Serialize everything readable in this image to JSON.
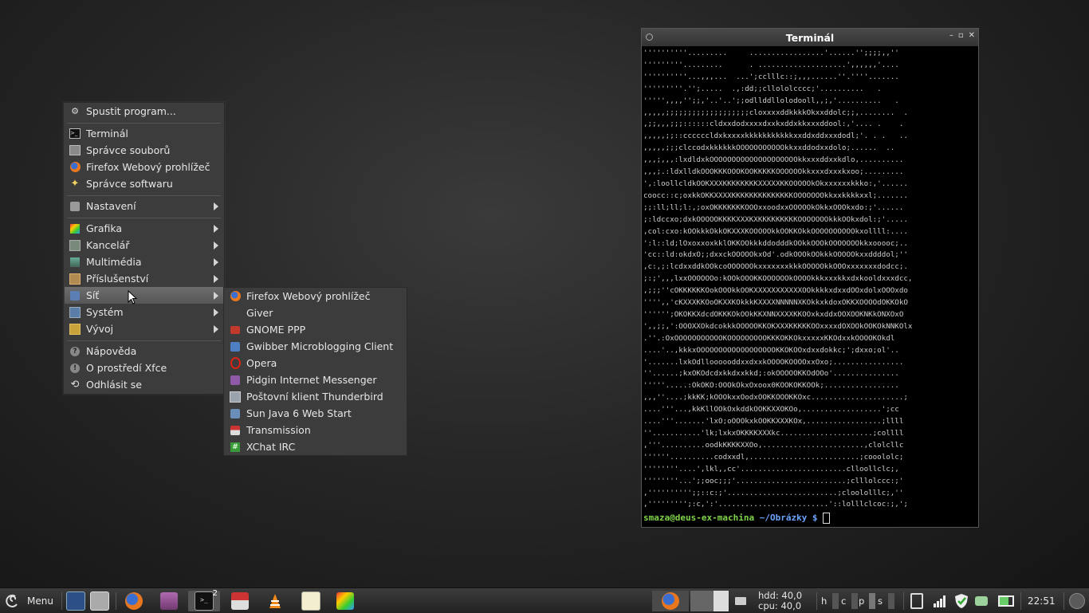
{
  "menu": {
    "items": [
      {
        "label": "Spustit program...",
        "icon": "gear-icon"
      },
      {
        "label": "Terminál",
        "icon": "terminal-icon"
      },
      {
        "label": "Správce souborů",
        "icon": "file-manager-icon"
      },
      {
        "label": "Firefox Webový prohlížeč",
        "icon": "firefox-icon"
      },
      {
        "label": "Správce softwaru",
        "icon": "software-star-icon"
      },
      {
        "label": "Nastavení",
        "icon": "settings-icon"
      },
      {
        "label": "Grafika",
        "icon": "graphics-icon"
      },
      {
        "label": "Kancelář",
        "icon": "office-icon"
      },
      {
        "label": "Multimédia",
        "icon": "multimedia-icon"
      },
      {
        "label": "Příslušenství",
        "icon": "accessories-icon"
      },
      {
        "label": "Síť",
        "icon": "network-icon"
      },
      {
        "label": "Systém",
        "icon": "system-icon"
      },
      {
        "label": "Vývoj",
        "icon": "development-icon"
      },
      {
        "label": "Nápověda",
        "icon": "help-icon"
      },
      {
        "label": "O prostředí Xfce",
        "icon": "info-icon"
      },
      {
        "label": "Odhlásit se",
        "icon": "logout-icon"
      }
    ]
  },
  "submenu": {
    "items": [
      {
        "label": "Firefox Webový prohlížeč",
        "icon": "firefox-icon"
      },
      {
        "label": "Giver",
        "icon": "giver-icon"
      },
      {
        "label": "GNOME PPP",
        "icon": "modem-icon"
      },
      {
        "label": "Gwibber Microblogging Client",
        "icon": "gwibber-icon"
      },
      {
        "label": "Opera",
        "icon": "opera-icon"
      },
      {
        "label": "Pidgin Internet Messenger",
        "icon": "pidgin-icon"
      },
      {
        "label": "Poštovní klient Thunderbird",
        "icon": "mail-icon"
      },
      {
        "label": "Sun Java 6 Web Start",
        "icon": "java-icon"
      },
      {
        "label": "Transmission",
        "icon": "transmission-icon"
      },
      {
        "label": "XChat IRC",
        "icon": "xchat-icon"
      }
    ]
  },
  "terminal": {
    "title": "Terminál",
    "ascii_art": "''''''''''.........     .................'......'';;;;,,''\n'''''''''.........      . ....................',,,,,,'....\n''''''''''...,,,...  ...';cclllc::;,,,......''.''''.......\n'''''''''.'';.....  .,:dd;;cllololcccc;'..........   .\n''''',,,,'';;,'..'..';;odllddllolodooll,,;,'..........   .\n,,,,,;;;;;;;;;;;;;;;;;;;cloxxxxddkkkkOkxxddolc;;,........  .\n,;;,,,;;;::::::cldxxdodxxxxdxxkxddxkkxxxddool:,'.... .    .\n,,,,,;;::ccccccldxkxxxxkkkkkkkkkkkxxddxddxxxdodl;'. . .   ..\n,,,,,;;;clccodxkkkkkkOOOOOOOOOOOkkxxddodxxdolo;......  ..\n,,,;,,,:lxdldxkOOOOOOOOOOOOOOOOOOOOkkxxxddxxkdlo,..........\n,,,;.:ldxlldkOOOKKKOOOKOOKKKKKOOOOOOkkxxxdxxxkxoo;.........\n',:loollcldkOOKXXXKKKKKKKKXXXXXKKOOOOOkOkxxxxxxkkko:,'......\ncoocc::c;oxkkOKKXXXXKKKKKKKKKKKKKKOOOOOOOkkxxkkkkxxl;.......\n;;:ll;ll;l:,;oxOKKKKKKKOOOxxoodxxOOOOOkOkkxOOOkxdo:;'......\n;:ldccxo;dxkOOOOOKKKKXXXKXKKKKKKKKKOOOOOOOkkkOOkxdol:;'.....\n,col:cxo:kOOkkkOkkOKXXXKOOOOOkkOOKKOkkOOOOOOOOOOkxollll:....\n':l::ld;lOxoxxoxkklOKKOOkkkddodddkOOkkOOOkOOOOOOOkkxooooc;..\n'cc::ld:okdxO;;dxxckOOOOOkxOd'.odkOOOkOOkkkOOOOOkxxddddol;''\n,c:,;:lcdxxddkOOkcoOOOOOOkxxxxxxxkkkOOOOOkkOOOxxxxxxxdodcc;.\n;:;',,,lxxOOOOOOo:kOOkOOOKKOOOOOOkOOOOkkkxxxkkxdxkooldxxxdcc,\n,;;;''cOKKKKKKOokOOOkkOOKXXXXXXXXXXXOOkkkkxdxxdOOxdolxOOOxdo\n'''',,'cKXXXKKOoOKXXKOkkkKXXXXNNNNNXKOkkxkdoxOKKXOOOOdOKKOkO\n'''''';OKOKKXdcdOKKKOkOOkKKXNNXXXXKKOOxkxddxOOXOOKNKkONXOxO\n',,;;,':OOOXXOkdcokkkOOOOOKKOKXXXKKKKKOOxxxxdOXOOkOOKOkNNKOlx\n.''.:OxOOOOOOOOOOOKOOOOOOOOOKKKOKKOkxxxxxKKOdxxkOOOOKOkdl\n....'..,kkkxOOOOOOOOOOOOOOOOOOKKOKOOxdxxdokkc;';dxxo;ol'..\n'.......lxkOdlloooooddxxdxxkOOOOKOOOOxxOxo;................\n''......;kxOKOdcdxkkdxxkkd;:okOOOOOKKOdOOo'...............\n'''''.....:OkOKO:OOOkOkxOxoox0KOOKOKKOOk;.................\n,,,''....;kkKK;kOOOkxxOodxOOKKOOOKKOxc.....................;\n....'''...,kkKllOOkOxkddkOOKKXXOKOo,..................';cc\n....'''.......'lxO;oOOOkxkOOKKXXXKOx,.................;llll\n''...........'lk;lxkxOKKKKXXXkc.....................;collll\n,'''..........oodkKKKKXXOo,.......................,clolcllc\n''''''..........codxxdl,.........................;cooololc;\n''''''''....',lkl,,cc'........................clloollclc;,\n''''''''...';;ooc;;;'.........................;clllolccc:;'\n,'''''''''';;::c:;'.........................;cloololllc;,''\n,''''''''';:c,':'.........................'::lolllclcoc:;,';",
    "prompt_user": "smaza@deus-ex-machina",
    "prompt_path": "~/Obrázky $"
  },
  "panel": {
    "menu_label": "Menu",
    "workspace_badge": "2",
    "hdd_label": "hdd: 40,0",
    "cpu_label": "cpu: 40,0",
    "indicators": [
      "h",
      "c",
      "p",
      "s"
    ],
    "clock": "22:51"
  }
}
